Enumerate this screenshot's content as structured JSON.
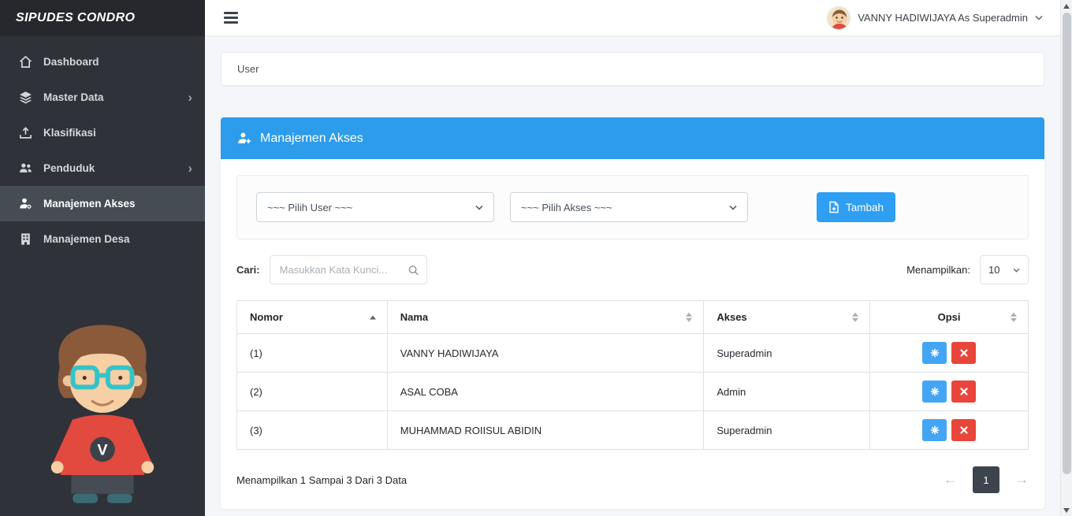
{
  "app": {
    "brand": "SIPUDES CONDRO"
  },
  "topbar": {
    "user_name": "VANNY HADIWIJAYA As Superadmin"
  },
  "sidebar": {
    "items": [
      {
        "label": "Dashboard",
        "icon": "home-icon",
        "chevron": false,
        "active": false
      },
      {
        "label": "Master Data",
        "icon": "layers-icon",
        "chevron": true,
        "active": false
      },
      {
        "label": "Klasifikasi",
        "icon": "upload-icon",
        "chevron": false,
        "active": false
      },
      {
        "label": "Penduduk",
        "icon": "users-icon",
        "chevron": true,
        "active": false
      },
      {
        "label": "Manajemen Akses",
        "icon": "user-cog-icon",
        "chevron": false,
        "active": true
      },
      {
        "label": "Manajemen Desa",
        "icon": "building-icon",
        "chevron": false,
        "active": false
      }
    ],
    "chevron_glyph": "›"
  },
  "breadcrumb": {
    "label": "User"
  },
  "panel": {
    "title": "Manajemen Akses",
    "filters": {
      "user_select": "~~~ Pilih User ~~~",
      "akses_select": "~~~ Pilih Akses ~~~",
      "add_button": "Tambah"
    },
    "search": {
      "label": "Cari:",
      "placeholder": "Masukkan Kata Kunci...",
      "show_label": "Menampilkan:",
      "page_size": "10"
    },
    "table": {
      "headers": [
        "Nomor",
        "Nama",
        "Akses",
        "Opsi"
      ],
      "rows": [
        {
          "nomor": "(1)",
          "nama": "VANNY HADIWIJAYA",
          "akses": "Superadmin"
        },
        {
          "nomor": "(2)",
          "nama": "ASAL COBA",
          "akses": "Admin"
        },
        {
          "nomor": "(3)",
          "nama": "MUHAMMAD ROIISUL ABIDIN",
          "akses": "Superadmin"
        }
      ]
    },
    "footer": {
      "info": "Menampilkan 1 Sampai 3 Dari 3 Data",
      "prev": "←",
      "page": "1",
      "next": "→"
    }
  },
  "colors": {
    "primary": "#2d9ceb",
    "button_blue": "#2e9ff3",
    "edit_blue": "#44a5f5",
    "danger_red": "#e8463c",
    "page_active": "#3e444d",
    "sidebar_bg": "#2f3238",
    "sidebar_active": "#464c54",
    "content_bg": "#f4f6f9"
  }
}
